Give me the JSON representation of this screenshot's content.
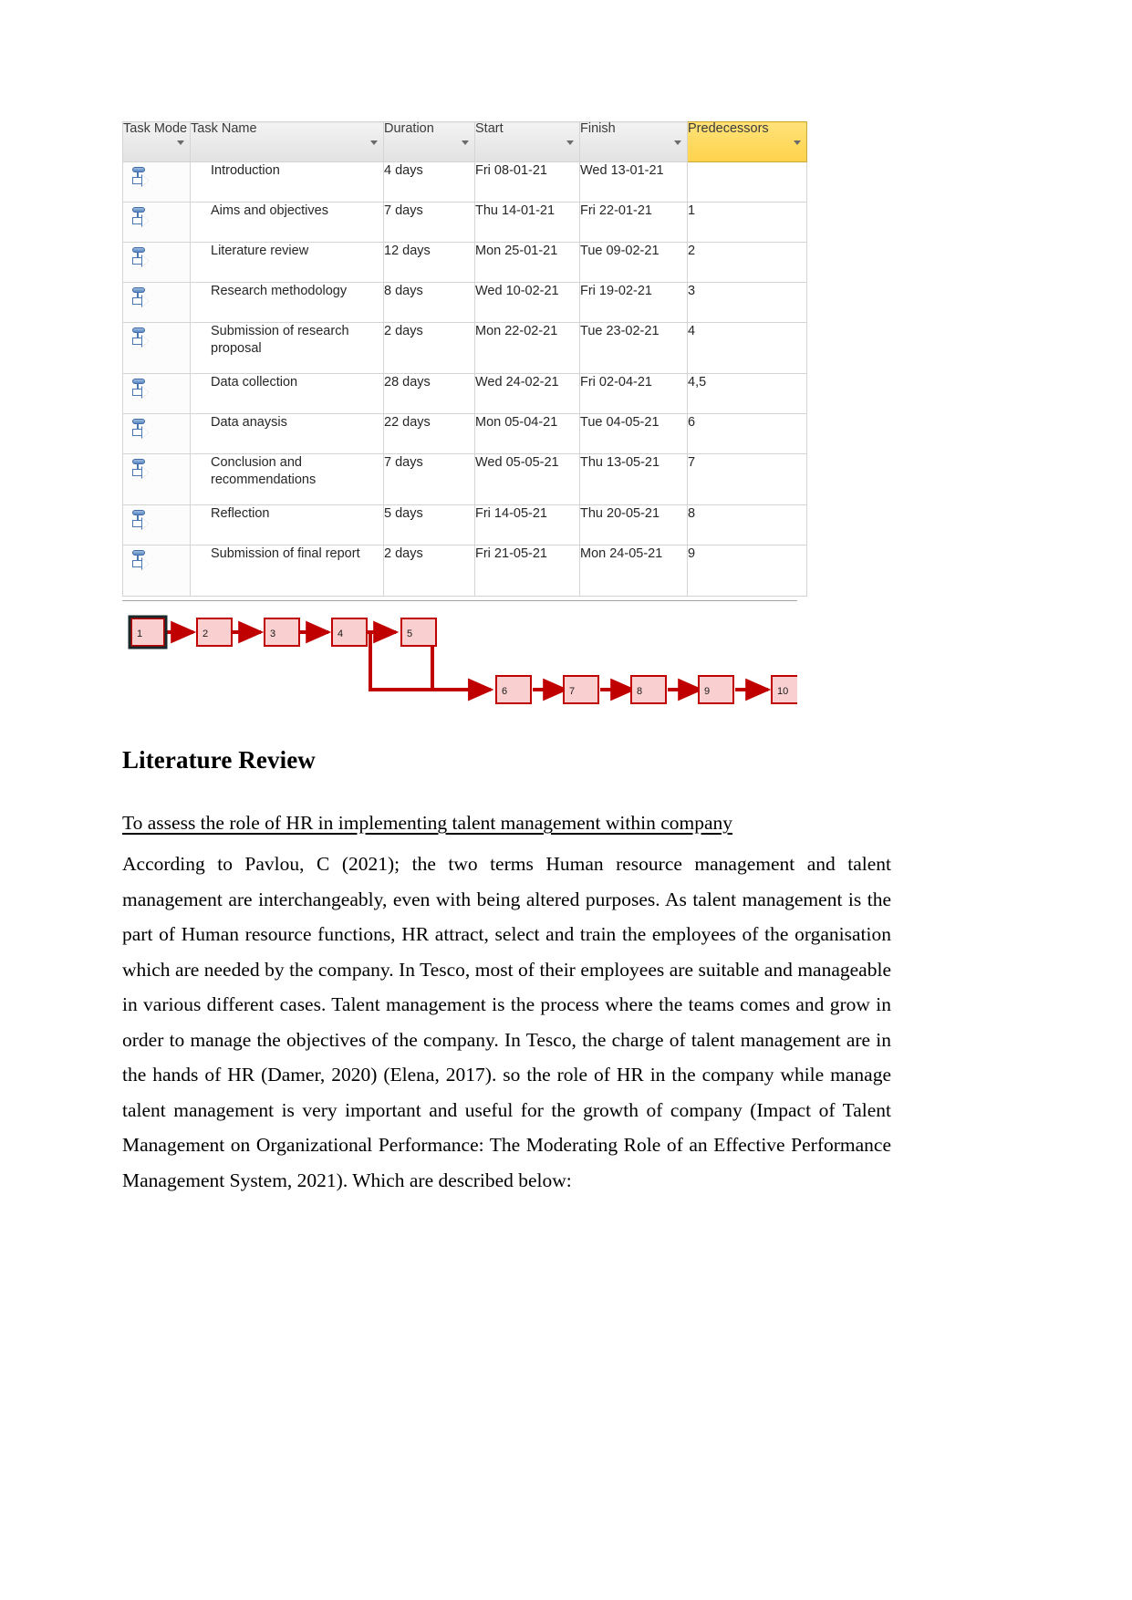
{
  "project_table": {
    "columns": [
      {
        "label": "Task Mode",
        "key": "mode"
      },
      {
        "label": "Task Name",
        "key": "name"
      },
      {
        "label": "Duration",
        "key": "duration"
      },
      {
        "label": "Start",
        "key": "start"
      },
      {
        "label": "Finish",
        "key": "finish"
      },
      {
        "label": "Predecessors",
        "key": "predecessors",
        "highlighted": true
      }
    ],
    "highlight_color": "#FFD95C",
    "rows": [
      {
        "mode": "auto-schedule-icon",
        "name": "Introduction",
        "duration": "4 days",
        "start": "Fri 08-01-21",
        "finish": "Wed 13-01-21",
        "predecessors": ""
      },
      {
        "mode": "auto-schedule-icon",
        "name": "Aims and objectives",
        "duration": "7 days",
        "start": "Thu 14-01-21",
        "finish": "Fri 22-01-21",
        "predecessors": "1"
      },
      {
        "mode": "auto-schedule-icon",
        "name": "Literature review",
        "duration": "12 days",
        "start": "Mon 25-01-21",
        "finish": "Tue 09-02-21",
        "predecessors": "2"
      },
      {
        "mode": "auto-schedule-icon",
        "name": "Research methodology",
        "duration": "8 days",
        "start": "Wed 10-02-21",
        "finish": "Fri 19-02-21",
        "predecessors": "3"
      },
      {
        "mode": "auto-schedule-icon",
        "name": "Submission of research proposal",
        "duration": "2 days",
        "start": "Mon 22-02-21",
        "finish": "Tue 23-02-21",
        "predecessors": "4"
      },
      {
        "mode": "auto-schedule-icon",
        "name": "Data collection",
        "duration": "28 days",
        "start": "Wed 24-02-21",
        "finish": "Fri 02-04-21",
        "predecessors": "4,5"
      },
      {
        "mode": "auto-schedule-icon",
        "name": "Data anaysis",
        "duration": "22 days",
        "start": "Mon 05-04-21",
        "finish": "Tue 04-05-21",
        "predecessors": "6"
      },
      {
        "mode": "auto-schedule-icon",
        "name": "Conclusion and recommendations",
        "duration": "7 days",
        "start": "Wed 05-05-21",
        "finish": "Thu 13-05-21",
        "predecessors": "7"
      },
      {
        "mode": "auto-schedule-icon",
        "name": "Reflection",
        "duration": "5 days",
        "start": "Fri 14-05-21",
        "finish": "Thu 20-05-21",
        "predecessors": "8"
      },
      {
        "mode": "auto-schedule-icon",
        "name": "Submission of final report",
        "duration": "2 days",
        "start": "Fri 21-05-21",
        "finish": "Mon 24-05-21",
        "predecessors": "9"
      }
    ]
  },
  "network_diagram": {
    "node_fill": "#F9CFCF",
    "node_stroke": "#C00000",
    "link_color": "#C00000",
    "selected_node": "1",
    "nodes": [
      {
        "id": "1",
        "label": "1",
        "selected": true
      },
      {
        "id": "2",
        "label": "2",
        "selected": false
      },
      {
        "id": "3",
        "label": "3",
        "selected": false
      },
      {
        "id": "4",
        "label": "4",
        "selected": false
      },
      {
        "id": "5",
        "label": "5",
        "selected": false
      },
      {
        "id": "6",
        "label": "6",
        "selected": false
      },
      {
        "id": "7",
        "label": "7",
        "selected": false
      },
      {
        "id": "8",
        "label": "8",
        "selected": false
      },
      {
        "id": "9",
        "label": "9",
        "selected": false
      },
      {
        "id": "10",
        "label": "10",
        "selected": false
      }
    ],
    "links": [
      {
        "from": "1",
        "to": "2"
      },
      {
        "from": "2",
        "to": "3"
      },
      {
        "from": "3",
        "to": "4"
      },
      {
        "from": "4",
        "to": "5"
      },
      {
        "from": "4",
        "to": "6"
      },
      {
        "from": "5",
        "to": "6"
      },
      {
        "from": "6",
        "to": "7"
      },
      {
        "from": "7",
        "to": "8"
      },
      {
        "from": "8",
        "to": "9"
      },
      {
        "from": "9",
        "to": "10"
      }
    ]
  },
  "document": {
    "heading": "Literature Review",
    "subheading": "To assess the role of HR in implementing talent management within company",
    "paragraph": "According to Pavlou, C (2021); the two terms Human resource management and talent management are interchangeably, even with being altered purposes. As talent management is the part of Human resource functions, HR attract, select and train the employees of the organisation which are needed by the company. In Tesco, most of their employees are suitable and manageable in various different cases. Talent management is the process where the teams comes and grow in order to manage the objectives of the company. In Tesco, the charge of talent management are in the hands of HR (Damer, 2020) (Elena, 2017). so the role of HR in the company while manage talent management is very important and useful for the growth of company (Impact of Talent Management on Organizational Performance: The Moderating Role of an Effective Performance Management System, 2021). Which are described below:"
  }
}
